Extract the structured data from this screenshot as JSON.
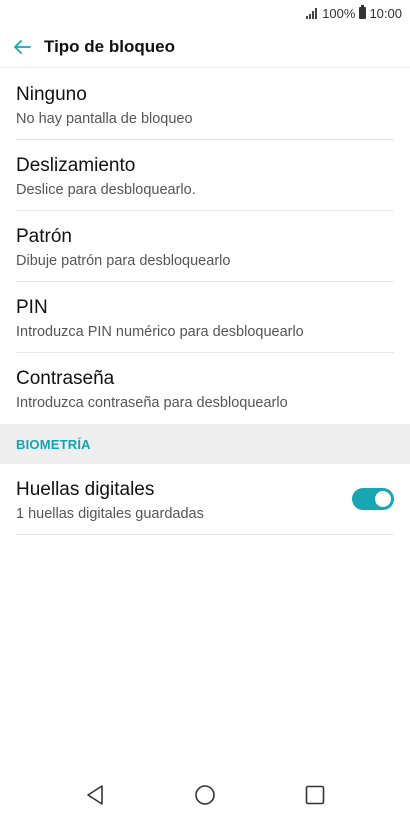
{
  "status_bar": {
    "battery_percent": "100%",
    "time": "10:00"
  },
  "header": {
    "title": "Tipo de bloqueo",
    "back_icon": "arrow-back-icon"
  },
  "options": [
    {
      "title": "Ninguno",
      "subtitle": "No hay pantalla de bloqueo"
    },
    {
      "title": "Deslizamiento",
      "subtitle": "Deslice para desbloquearlo."
    },
    {
      "title": "Patrón",
      "subtitle": "Dibuje patrón para desbloquearlo"
    },
    {
      "title": "PIN",
      "subtitle": "Introduzca PIN numérico para desbloquearlo"
    },
    {
      "title": "Contraseña",
      "subtitle": "Introduzca contraseña para desbloquearlo"
    }
  ],
  "biometrics": {
    "section_label": "BIOMETRÍA",
    "fingerprint": {
      "title": "Huellas digitales",
      "subtitle": "1 huellas digitales guardadas",
      "enabled": true
    }
  },
  "nav_bar": {
    "back_icon": "triangle-back-icon",
    "home_icon": "circle-home-icon",
    "recents_icon": "square-recents-icon"
  },
  "colors": {
    "accent": "#17a6b2",
    "section_bg": "#eeeeee"
  }
}
